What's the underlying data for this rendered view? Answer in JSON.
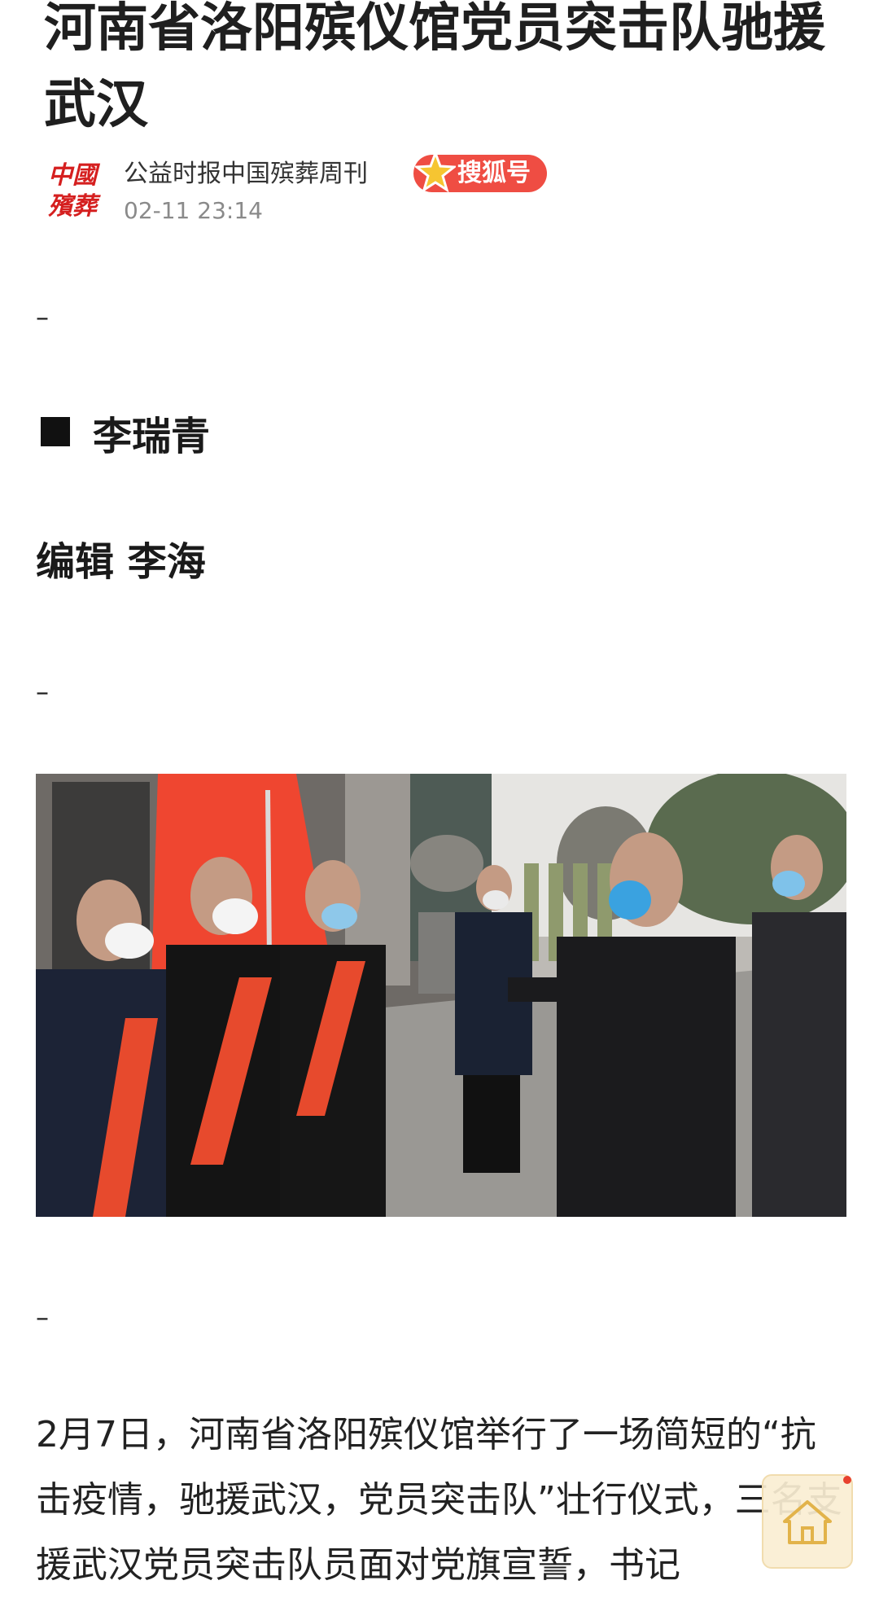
{
  "article": {
    "title": "河南省洛阳殡仪馆党员突击队驰援武汉",
    "author": "公益时报中国殡葬周刊",
    "badge": "搜狐号",
    "date": "02-11 23:14",
    "logo_text_line1": "中國",
    "logo_text_line2": "殯葬",
    "dash": "–",
    "byline": "李瑞青",
    "editor": "编辑 李海",
    "paragraph": "2月7日，河南省洛阳殡仪馆举行了一场简短的“抗击疫情，驰援武汉，党员突击队”壮行仪式，三名支援武汉党员突击队员面对党旗宣誓，书记"
  },
  "colors": {
    "badge_red": "#ef4d43",
    "logo_red": "#d51f1f",
    "star_gold": "#f6c531"
  },
  "icons": {
    "badge": "star-icon",
    "float": "home-icon"
  }
}
